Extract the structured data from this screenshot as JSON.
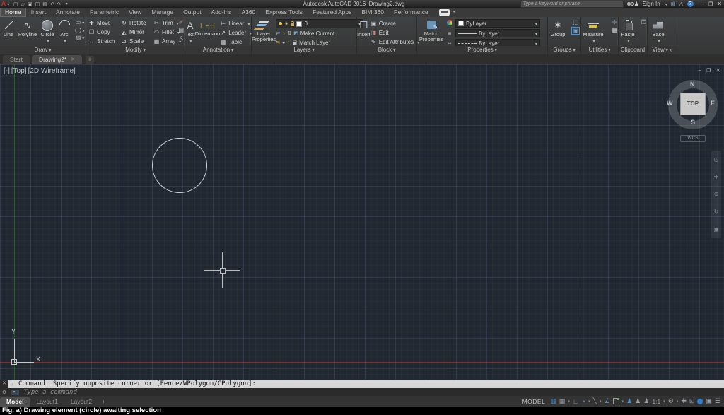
{
  "title_bar": {
    "app": "Autodesk AutoCAD 2016",
    "doc": "Drawing2.dwg",
    "search": "Type a keyword or phrase",
    "signin": "Sign In"
  },
  "menu_tabs": [
    "Home",
    "Insert",
    "Annotate",
    "Parametric",
    "View",
    "Manage",
    "Output",
    "Add-ins",
    "A360",
    "Express Tools",
    "Featured Apps",
    "BIM 360",
    "Performance"
  ],
  "ribbon": {
    "draw": {
      "label": "Draw",
      "buttons": [
        "Line",
        "Polyline",
        "Circle",
        "Arc"
      ]
    },
    "modify": {
      "label": "Modify",
      "buttons": [
        "Move",
        "Rotate",
        "Trim",
        "Copy",
        "Mirror",
        "Fillet",
        "Stretch",
        "Scale",
        "Array"
      ]
    },
    "annotation": {
      "label": "Annotation",
      "text_label": "Text",
      "dimension_label": "Dimension",
      "items": [
        "Linear",
        "Leader",
        "Table"
      ]
    },
    "layers": {
      "label": "Layers",
      "big": "Layer Properties",
      "current_layer": "0",
      "make_current": "Make Current",
      "match_layer": "Match Layer"
    },
    "block": {
      "label": "Block",
      "big": "Insert",
      "items": [
        "Create",
        "Edit",
        "Edit Attributes"
      ]
    },
    "properties": {
      "label": "Properties",
      "big": "Match Properties",
      "color": "ByLayer",
      "lineweight": "ByLayer",
      "linetype": "ByLayer"
    },
    "groups": {
      "label": "Groups",
      "big": "Group"
    },
    "utilities": {
      "label": "Utilities",
      "big": "Measure"
    },
    "clipboard": {
      "label": "Clipboard",
      "big": "Paste"
    },
    "view": {
      "label": "View",
      "big": "Base"
    }
  },
  "file_tabs": [
    "Start",
    "Drawing2*"
  ],
  "viewport": {
    "controls": [
      "[-]",
      "[Top]",
      "[2D Wireframe]"
    ],
    "viewcube": {
      "north": "N",
      "east": "E",
      "south": "S",
      "west": "W",
      "face": "TOP",
      "ucs": "WCS"
    },
    "ucs_axis": {
      "x": "X",
      "y": "Y"
    }
  },
  "command": {
    "history": "Command: Specify opposite corner or [Fence/WPolygon/CPolygon]:",
    "placeholder": "Type a command",
    "prompt": ">_"
  },
  "layout_tabs": [
    "Model",
    "Layout1",
    "Layout2"
  ],
  "status_bar": {
    "model": "MODEL",
    "scale": "1:1"
  },
  "caption": "Fig. a) Drawing element (circle) awaiting selection",
  "colors": {
    "accent_blue": "#4e8fd0",
    "canvas": "#212831",
    "axis_red": "#aa3c34",
    "axis_green": "#559146"
  }
}
